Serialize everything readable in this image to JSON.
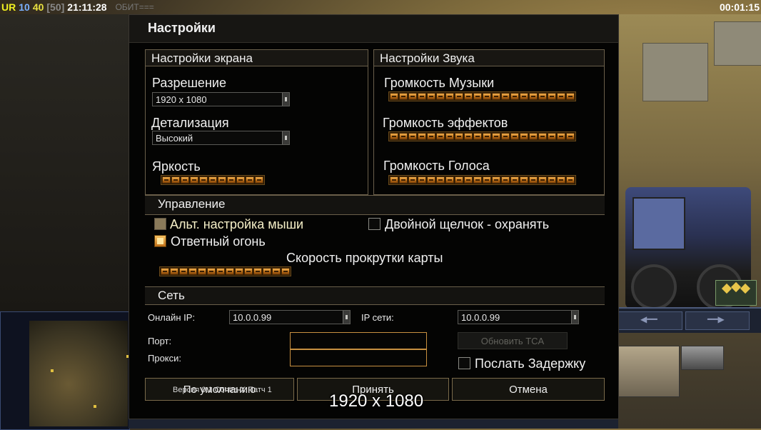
{
  "hud": {
    "ur": "UR",
    "n1": "10",
    "n2": "40",
    "n3": "[50]",
    "time": "21:11:28",
    "chat_fragment": "ОБИТ===",
    "timer": "00:01:15"
  },
  "dialog": {
    "title": "Настройки",
    "screen": {
      "header": "Настройки экрана",
      "resolution_label": "Разрешение",
      "resolution_value": "1920 x 1080",
      "detail_label": "Детализация",
      "detail_value": "Высокий",
      "brightness_label": "Яркость",
      "brightness_level": 1.0
    },
    "sound": {
      "header": "Настройки Звука",
      "music_label": "Громкость Музыки",
      "music_level": 1.0,
      "effects_label": "Громкость эффектов",
      "effects_level": 1.0,
      "voice_label": "Громкость Голоса",
      "voice_level": 1.0
    },
    "control": {
      "header": "Управление",
      "alt_mouse_label": "Альт. настройка мыши",
      "double_click_label": "Двойной щелчок - охранять",
      "return_fire_label": "Ответный огонь",
      "scroll_speed_label": "Скорость прокрутки карты",
      "scroll_speed_level": 1.0
    },
    "network": {
      "header": "Сеть",
      "online_ip_label": "Онлайн IP:",
      "online_ip_value": "10.0.0.99",
      "lan_ip_label": "IP сети:",
      "lan_ip_value": "10.0.0.99",
      "port_label": "Порт:",
      "proxy_label": "Прокси:",
      "update_tca_label": "Обновить TCA",
      "send_delay_label": "Послать Задержку"
    },
    "buttons": {
      "defaults": "По умолчанию",
      "accept": "Принять",
      "cancel": "Отмена"
    },
    "version": "Версия 0.1  Contra X Патч 1"
  },
  "overlay_resolution": "1920 x 1080",
  "colors": {
    "accent_orange": "#c07018",
    "border_gold": "#6a5f4a",
    "dialog_bg": "#040403"
  }
}
